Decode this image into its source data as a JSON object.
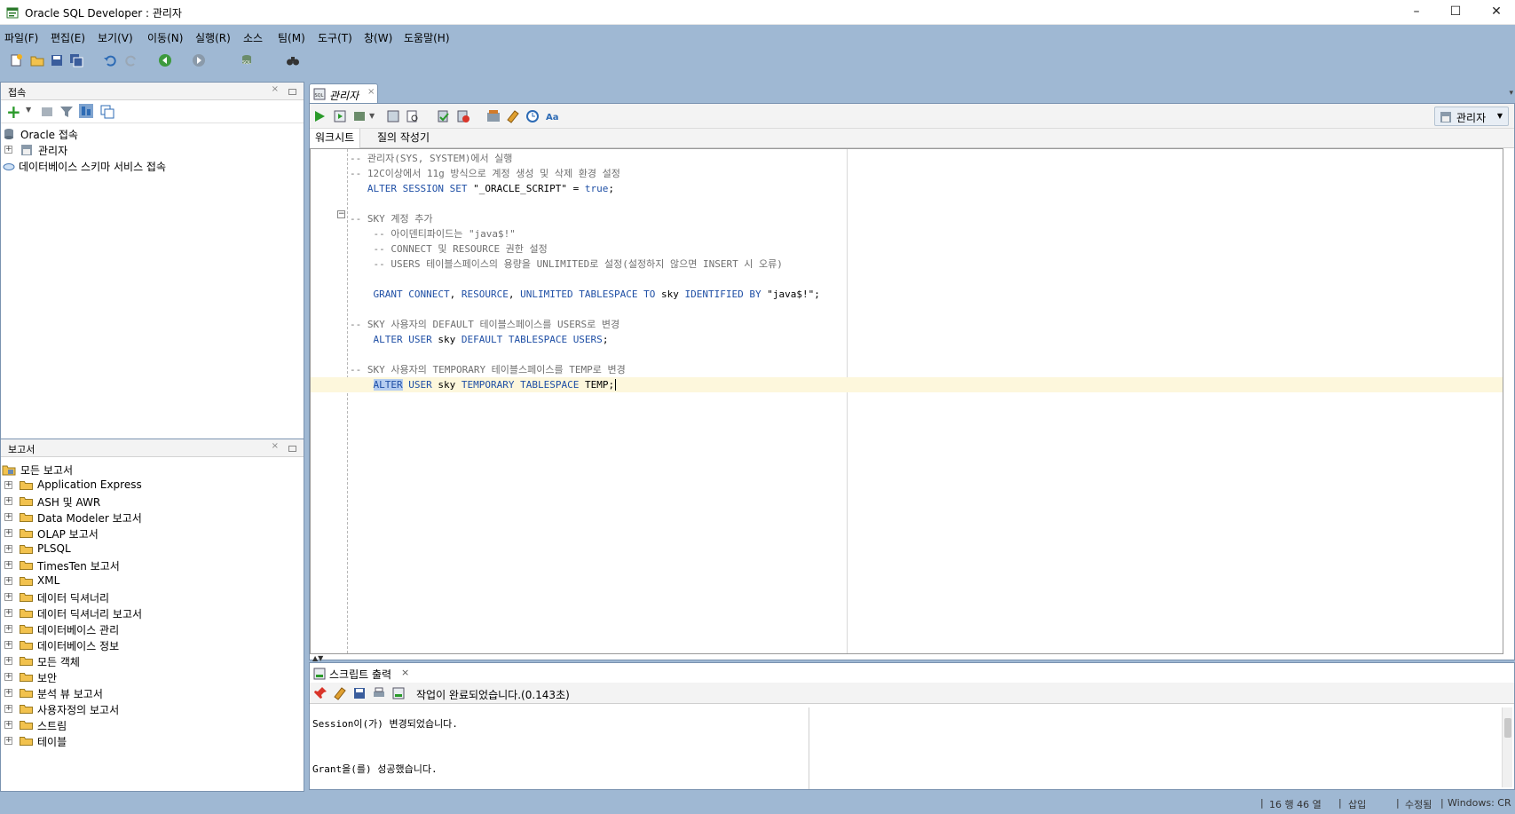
{
  "window": {
    "title": "Oracle SQL Developer : 관리자",
    "minimize": "–",
    "maximize": "☐",
    "close": "✕"
  },
  "menu": [
    "파일(F)",
    "편집(E)",
    "보기(V)",
    "이동(N)",
    "실행(R)",
    "소스",
    "팀(M)",
    "도구(T)",
    "창(W)",
    "도움말(H)"
  ],
  "connections_panel": {
    "title": "접속",
    "close": "×",
    "items": [
      {
        "label": "Oracle 접속",
        "icon": "database-icon"
      },
      {
        "label": "관리자",
        "icon": "connection-icon"
      },
      {
        "label": "데이터베이스 스키마 서비스 접속",
        "icon": "cloud-icon"
      }
    ]
  },
  "reports_panel": {
    "title": "보고서",
    "close": "×",
    "root": "모든 보고서",
    "items": [
      "Application Express",
      "ASH 및 AWR",
      "Data Modeler 보고서",
      "OLAP 보고서",
      "PLSQL",
      "TimesTen 보고서",
      "XML",
      "데이터 딕셔너리",
      "데이터 딕셔너리 보고서",
      "데이터베이스 관리",
      "데이터베이스 정보",
      "모든 객체",
      "보안",
      "분석 뷰 보고서",
      "사용자정의 보고서",
      "스트림",
      "테이블"
    ]
  },
  "editor": {
    "doc_tab": "관리자",
    "doc_tab_close": "×",
    "connection_selector": "관리자",
    "sub_tabs": [
      "워크시트",
      "질의 작성기"
    ],
    "code_lines": [
      [
        {
          "t": "-- 관리자(SYS, SYSTEM)에서 실행",
          "c": "cmt"
        }
      ],
      [
        {
          "t": "-- 12C이상에서 11g 방식으로 계정 생성 및 삭제 환경 설정",
          "c": "cmt"
        }
      ],
      [
        {
          "t": "   ",
          "c": "id"
        },
        {
          "t": "ALTER SESSION SET",
          "c": "kw"
        },
        {
          "t": " \"_ORACLE_SCRIPT\" = ",
          "c": "str"
        },
        {
          "t": "true",
          "c": "kw"
        },
        {
          "t": ";",
          "c": "id"
        }
      ],
      [
        {
          "t": "",
          "c": "id"
        }
      ],
      [
        {
          "t": "-- SKY 계정 추가",
          "c": "cmt"
        }
      ],
      [
        {
          "t": "    -- 아이덴티파이드는 \"java$!\"",
          "c": "cmt"
        }
      ],
      [
        {
          "t": "    -- CONNECT 및 RESOURCE 권한 설정",
          "c": "cmt"
        }
      ],
      [
        {
          "t": "    -- USERS 테이블스페이스의 용량을 UNLIMITED로 설정(설정하지 않으면 INSERT 시 오류)",
          "c": "cmt"
        }
      ],
      [
        {
          "t": "",
          "c": "id"
        }
      ],
      [
        {
          "t": "    ",
          "c": "id"
        },
        {
          "t": "GRANT CONNECT",
          "c": "kw"
        },
        {
          "t": ", ",
          "c": "id"
        },
        {
          "t": "RESOURCE",
          "c": "kw"
        },
        {
          "t": ", ",
          "c": "id"
        },
        {
          "t": "UNLIMITED TABLESPACE TO",
          "c": "kw"
        },
        {
          "t": " sky ",
          "c": "id"
        },
        {
          "t": "IDENTIFIED BY",
          "c": "kw"
        },
        {
          "t": " \"java$!\";",
          "c": "str"
        }
      ],
      [
        {
          "t": "",
          "c": "id"
        }
      ],
      [
        {
          "t": "-- SKY 사용자의 DEFAULT 테이블스페이스를 USERS로 변경",
          "c": "cmt"
        }
      ],
      [
        {
          "t": "    ",
          "c": "id"
        },
        {
          "t": "ALTER USER",
          "c": "kw"
        },
        {
          "t": " sky ",
          "c": "id"
        },
        {
          "t": "DEFAULT TABLESPACE USERS",
          "c": "kw"
        },
        {
          "t": ";",
          "c": "id"
        }
      ],
      [
        {
          "t": "",
          "c": "id"
        }
      ],
      [
        {
          "t": "-- SKY 사용자의 TEMPORARY 테이블스페이스를 TEMP로 변경",
          "c": "cmt"
        }
      ],
      [
        {
          "t": "    ",
          "c": "id"
        },
        {
          "t": "ALTER",
          "c": "kw sel"
        },
        {
          "t": " ",
          "c": "id"
        },
        {
          "t": "USER",
          "c": "kw"
        },
        {
          "t": " sky ",
          "c": "id"
        },
        {
          "t": "TEMPORARY TABLESPACE",
          "c": "kw"
        },
        {
          "t": " TEMP;",
          "c": "id"
        }
      ]
    ]
  },
  "output": {
    "tab_label": "스크립트 출력",
    "tab_close": "×",
    "status": "작업이 완료되었습니다.(0.143초)",
    "lines": [
      "Session이(가) 변경되었습니다.",
      "Grant을(를) 성공했습니다."
    ]
  },
  "statusbar": {
    "position": "16 행 46 열",
    "mode": "삽입",
    "modified": "수정됨",
    "line_ending": "Windows: CR"
  }
}
